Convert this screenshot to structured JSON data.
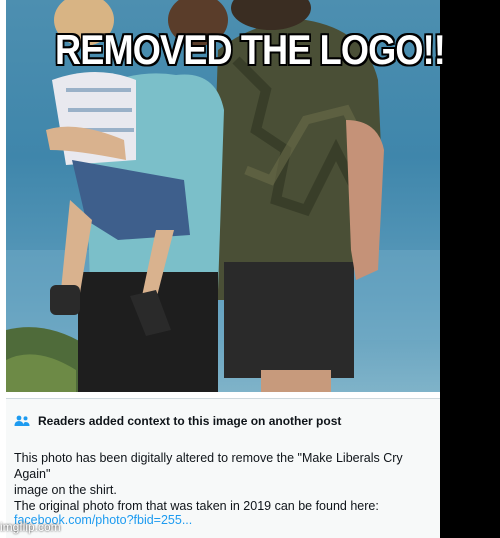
{
  "caption": {
    "text": "REMOVED THE LOGO!!"
  },
  "photo": {
    "description_icon": "photo-of-family"
  },
  "community_note": {
    "icon": "people-icon",
    "header": "Readers added context to this image on another post",
    "body_line1": "This photo has been digitally altered to remove the \"Make Liberals Cry Again\"",
    "body_line2": "image on the shirt.",
    "body_line3": "The original photo from that was taken in 2019 can be found here:",
    "link": "facebook.com/photo?fbid=255..."
  },
  "watermark": {
    "text": "imgflip.com"
  },
  "colors": {
    "link": "#1d9bf0",
    "card_bg": "#f7f9f9",
    "right_bar": "#000000"
  }
}
